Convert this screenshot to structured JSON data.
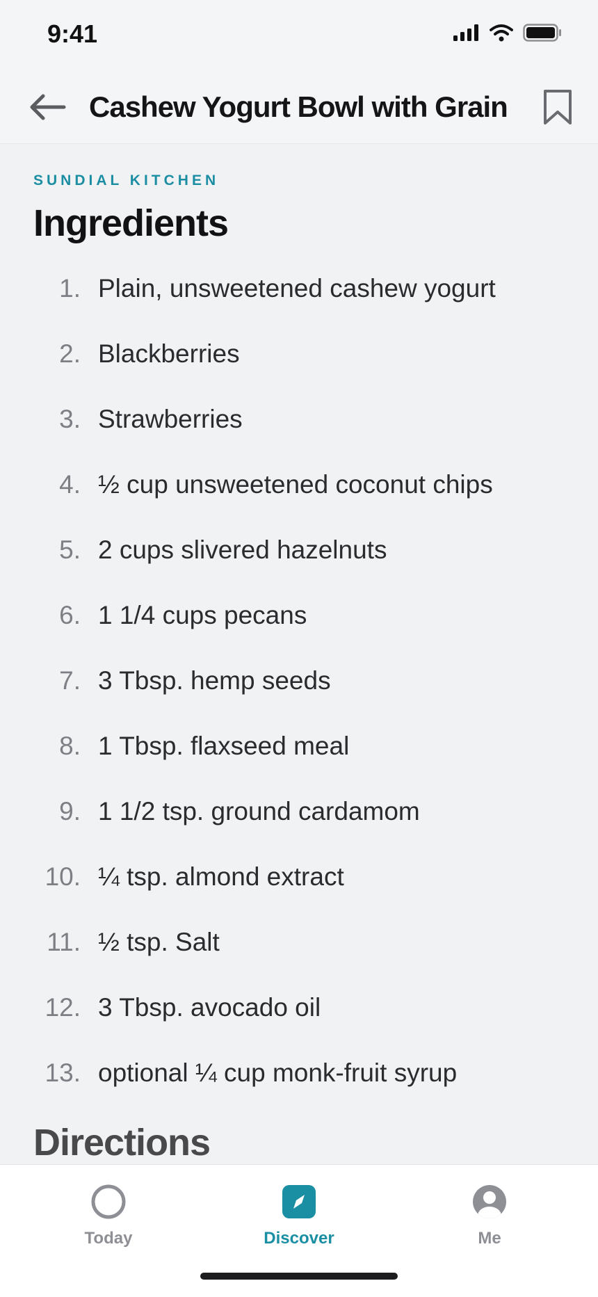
{
  "status_bar": {
    "time": "9:41"
  },
  "header": {
    "title": "Cashew Yogurt Bowl with Grain"
  },
  "recipe": {
    "source": "SUNDIAL KITCHEN",
    "ingredients_title": "Ingredients",
    "ingredients": [
      {
        "num": "1.",
        "text": "Plain, unsweetened cashew yogurt"
      },
      {
        "num": "2.",
        "text": "Blackberries"
      },
      {
        "num": "3.",
        "text": "Strawberries"
      },
      {
        "num": "4.",
        "text": "½ cup unsweetened coconut chips"
      },
      {
        "num": "5.",
        "text": "2 cups slivered hazelnuts"
      },
      {
        "num": "6.",
        "text": "1 1/4 cups pecans"
      },
      {
        "num": "7.",
        "text": "3 Tbsp. hemp seeds"
      },
      {
        "num": "8.",
        "text": "1 Tbsp. flaxseed meal"
      },
      {
        "num": "9.",
        "text": "1 1/2 tsp. ground cardamom"
      },
      {
        "num": "10.",
        "text": "¼ tsp. almond extract"
      },
      {
        "num": "11.",
        "text": "½ tsp. Salt"
      },
      {
        "num": "12.",
        "text": "3 Tbsp. avocado oil"
      },
      {
        "num": "13.",
        "text": "optional ¼ cup monk-fruit syrup"
      }
    ],
    "directions_title": "Directions"
  },
  "tabs": [
    {
      "label": "Today",
      "icon": "circle-icon",
      "active": false
    },
    {
      "label": "Discover",
      "icon": "compass-icon",
      "active": true
    },
    {
      "label": "Me",
      "icon": "profile-icon",
      "active": false
    }
  ],
  "colors": {
    "accent": "#1a8ea3",
    "background": "#f1f2f4",
    "inactive": "#8d8f94"
  }
}
